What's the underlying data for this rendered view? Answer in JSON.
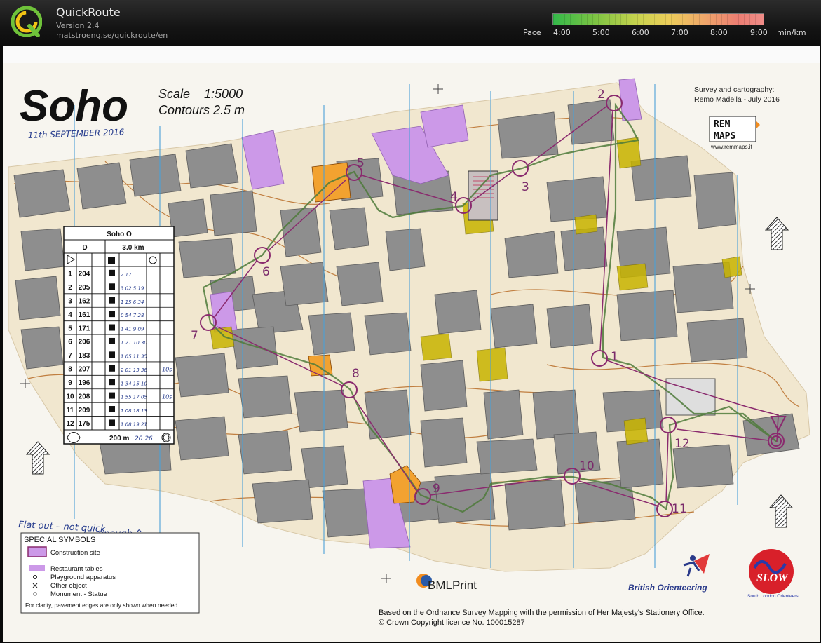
{
  "app": {
    "title": "QuickRoute",
    "version": "Version 2.4",
    "url": "matstroeng.se/quickroute/en",
    "logo_letter": "Q"
  },
  "pace_scale": {
    "label": "Pace",
    "ticks": [
      "4:00",
      "5:00",
      "6:00",
      "7:00",
      "8:00",
      "9:00"
    ],
    "unit": "min/km"
  },
  "colors": {
    "building": "#8e8e8e",
    "paved": "#f3ead6",
    "restricted": "#cc99e8",
    "course": "#8a2a6e",
    "route": "#4d7a3a",
    "contour": "#b5651d",
    "north_line": "#4aa0d8",
    "canopy": "#c8b400"
  },
  "map": {
    "title": "Soho",
    "scale": "Scale    1:5000",
    "contours": "Contours 2.5 m",
    "handwritten_date": "11th SEPTEMBER 2016",
    "handwritten_note_1": "Flat out – not quick",
    "handwritten_note_2": "enough ^",
    "survey_line_1": "Survey and cartography:",
    "survey_line_2": "Remo Madella - July 2016",
    "logo_rem": "REM",
    "logo_maps": "MAPS",
    "logo_site": "www.remmaps.it",
    "copyright_1": "Based on the Ordnance Survey Mapping with the permission of Her Majesty's Stationery Office.",
    "copyright_2": "© Crown Copyright licence No. 100015287",
    "sponsor_bml": "BMLPrint",
    "sponsor_bof": "British Orienteering",
    "sponsor_slow": "SLOW",
    "sponsor_slow_sub": "South London Orienteers"
  },
  "controls": [
    {
      "number": "1"
    },
    {
      "number": "2"
    },
    {
      "number": "3"
    },
    {
      "number": "4"
    },
    {
      "number": "5"
    },
    {
      "number": "6"
    },
    {
      "number": "7"
    },
    {
      "number": "8"
    },
    {
      "number": "9"
    },
    {
      "number": "10"
    },
    {
      "number": "11"
    },
    {
      "number": "12"
    }
  ],
  "description_sheet": {
    "title": "Soho O",
    "class": "D",
    "length": "3.0 km",
    "rows": [
      {
        "n": "1",
        "code": "204",
        "note": "2 17"
      },
      {
        "n": "2",
        "code": "205",
        "note": "3 02  5 19"
      },
      {
        "n": "3",
        "code": "162",
        "note": "1 15  6 34"
      },
      {
        "n": "4",
        "code": "161",
        "note": "0 54  7 28"
      },
      {
        "n": "5",
        "code": "171",
        "note": "1 41  9 09"
      },
      {
        "n": "6",
        "code": "206",
        "note": "1 21  10 30"
      },
      {
        "n": "7",
        "code": "183",
        "note": "1 05  11 35"
      },
      {
        "n": "8",
        "code": "207",
        "note": "2 01  13 36",
        "side": "10s"
      },
      {
        "n": "9",
        "code": "196",
        "note": "1 34  15 10"
      },
      {
        "n": "10",
        "code": "208",
        "note": "1 55  17 05",
        "side": "10s"
      },
      {
        "n": "11",
        "code": "209",
        "note": "1 08  18 13"
      },
      {
        "n": "12",
        "code": "175",
        "note": "1 08  19 21"
      }
    ],
    "finish": "200 m",
    "finish_note": "20 26"
  },
  "legend": {
    "title": "SPECIAL SYMBOLS",
    "items": [
      "Construction site",
      "Restaurant tables",
      "Playground apparatus",
      "Other object",
      "Monument - Statue"
    ],
    "footnote": "For clarity, pavement edges are only shown when needed."
  }
}
